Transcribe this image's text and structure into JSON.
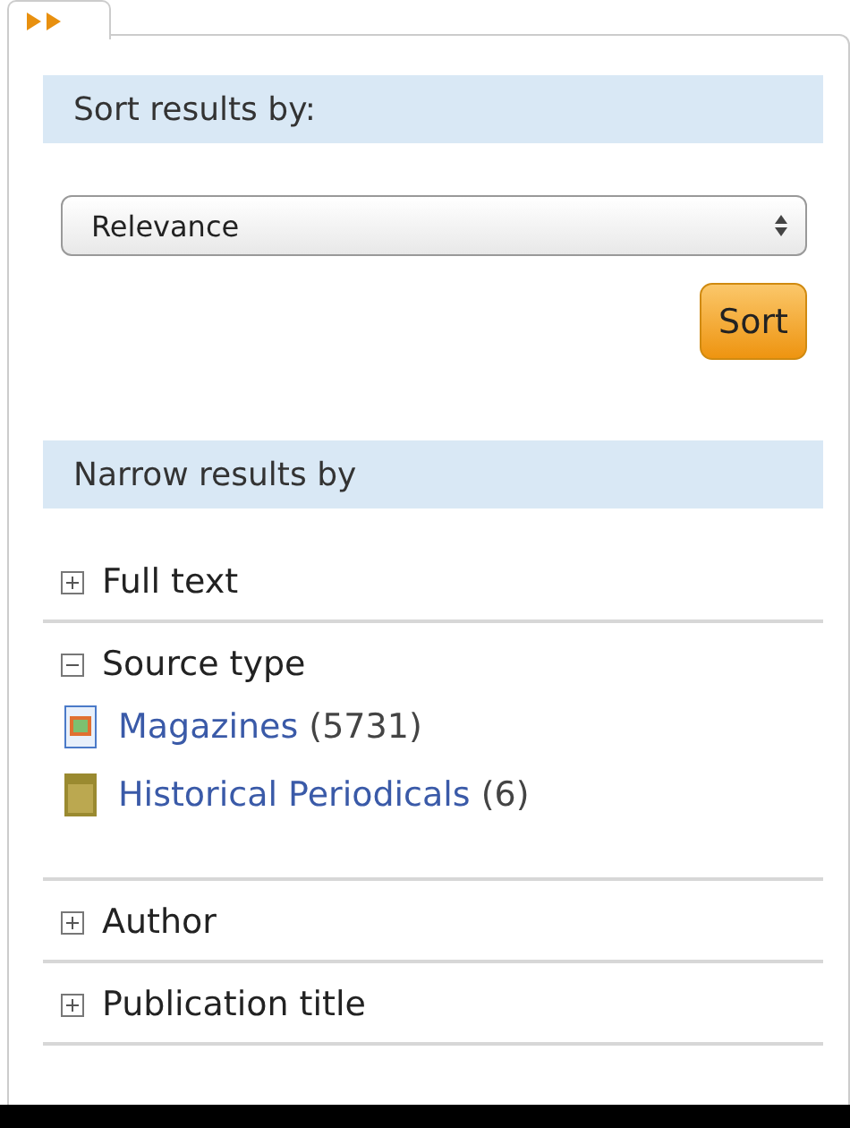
{
  "sort": {
    "heading": "Sort results by:",
    "select_value": "Relevance",
    "button": "Sort"
  },
  "narrow": {
    "heading": "Narrow results by",
    "facets": [
      {
        "label": "Full text",
        "expanded": false
      },
      {
        "label": "Source type",
        "expanded": true,
        "items": [
          {
            "kind": "magazine",
            "name": "Magazines",
            "count": "(5731)"
          },
          {
            "kind": "periodical",
            "name": "Historical Periodicals",
            "count": "(6)"
          }
        ]
      },
      {
        "label": "Author",
        "expanded": false
      },
      {
        "label": "Publication title",
        "expanded": false
      }
    ]
  }
}
